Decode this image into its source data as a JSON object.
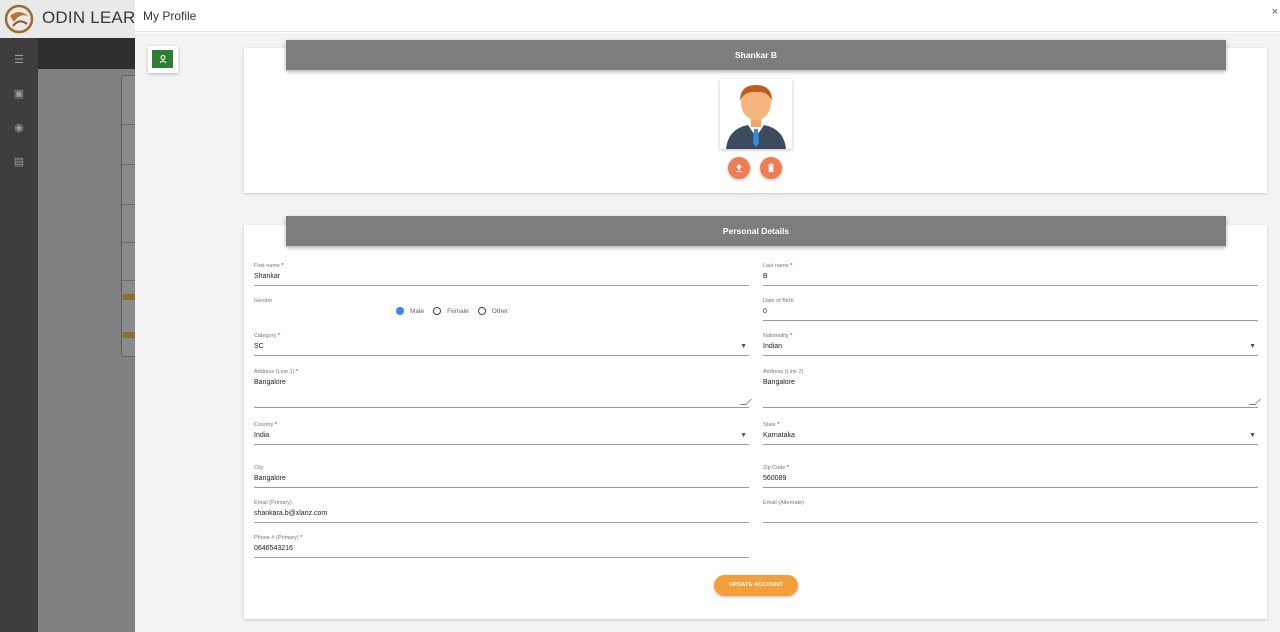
{
  "background_app": {
    "title": "ODIN LEARNIN"
  },
  "modal": {
    "title": "My Profile",
    "close_label": "×"
  },
  "profile_card": {
    "name": "Shankar B"
  },
  "personal_details": {
    "header": "Personal Details",
    "required_mark": "*",
    "first_name": {
      "label": "First name",
      "value": "Shankar"
    },
    "last_name": {
      "label": "Last name",
      "value": "B"
    },
    "gender": {
      "label": "Gender",
      "options": [
        "Male",
        "Female",
        "Other"
      ],
      "selected": "Male"
    },
    "date_of_birth": {
      "label": "Date of Birth",
      "value": "0"
    },
    "category": {
      "label": "Category",
      "value": "SC"
    },
    "nationality": {
      "label": "Nationality",
      "value": "Indian"
    },
    "address_line1": {
      "label": "Address (Line 1)",
      "value": "Bangalore"
    },
    "address_line2": {
      "label": "Address (Line 2)",
      "value": "Bangalore"
    },
    "country": {
      "label": "Country",
      "value": "India"
    },
    "state": {
      "label": "State",
      "value": "Karnataka"
    },
    "city": {
      "label": "City",
      "value": "Bangalore"
    },
    "zip_code": {
      "label": "Zip Code",
      "value": "560089"
    },
    "email_primary": {
      "label": "Email (Primary)",
      "value": "shankara.b@xlanz.com"
    },
    "email_alternate": {
      "label": "Email (Alternate)",
      "value": ""
    },
    "phone_primary": {
      "label": "Phone # (Primary)",
      "value": "0646543216"
    },
    "update_button": "UPDATE ACCOUNT"
  }
}
